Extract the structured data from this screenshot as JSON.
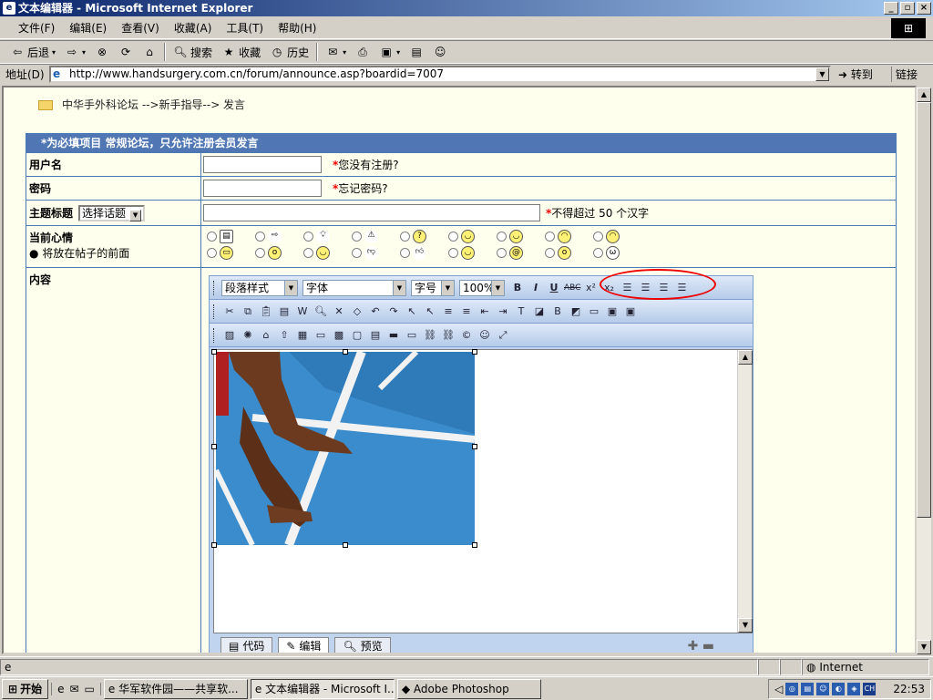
{
  "window": {
    "title": "文本编辑器 - Microsoft Internet Explorer"
  },
  "menu": [
    "文件(F)",
    "编辑(E)",
    "查看(V)",
    "收藏(A)",
    "工具(T)",
    "帮助(H)"
  ],
  "toolbar": {
    "back": "后退",
    "search": "搜索",
    "favorites": "收藏",
    "history": "历史"
  },
  "address": {
    "label": "地址(D)",
    "url": "http://www.handsurgery.com.cn/forum/announce.asp?boardid=7007",
    "go": "转到",
    "links": "链接"
  },
  "breadcrumb": "中华手外科论坛 -->新手指导--> 发言",
  "form": {
    "header": "*为必填项目 常规论坛，只允许注册会员发言",
    "username_label": "用户名",
    "username_hint": "您没有注册?",
    "password_label": "密码",
    "password_hint": "忘记密码?",
    "subject_label": "主题标题",
    "subject_select": "选择话题",
    "subject_hint": "不得超过 50 个汉字",
    "mood_label": "当前心情",
    "mood_sub": "● 将放在帖子的前面",
    "content_label": "内容"
  },
  "editor": {
    "para_style": "段落样式",
    "font": "字体",
    "size": "字号",
    "zoom": "100%",
    "tabs": {
      "code": "代码",
      "edit": "编辑",
      "preview": "预览"
    }
  },
  "status": {
    "zone": "Internet"
  },
  "taskbar": {
    "start": "开始",
    "tasks": [
      "华军软件园——共享软...",
      "文本编辑器 - Microsoft I...",
      "Adobe Photoshop"
    ],
    "lang": "CH",
    "clock": "22:53"
  },
  "colors": {
    "title_bar": "#0a246a",
    "form_header": "#5077b4",
    "form_bg": "#ffffee",
    "annotation": "#e00000"
  }
}
